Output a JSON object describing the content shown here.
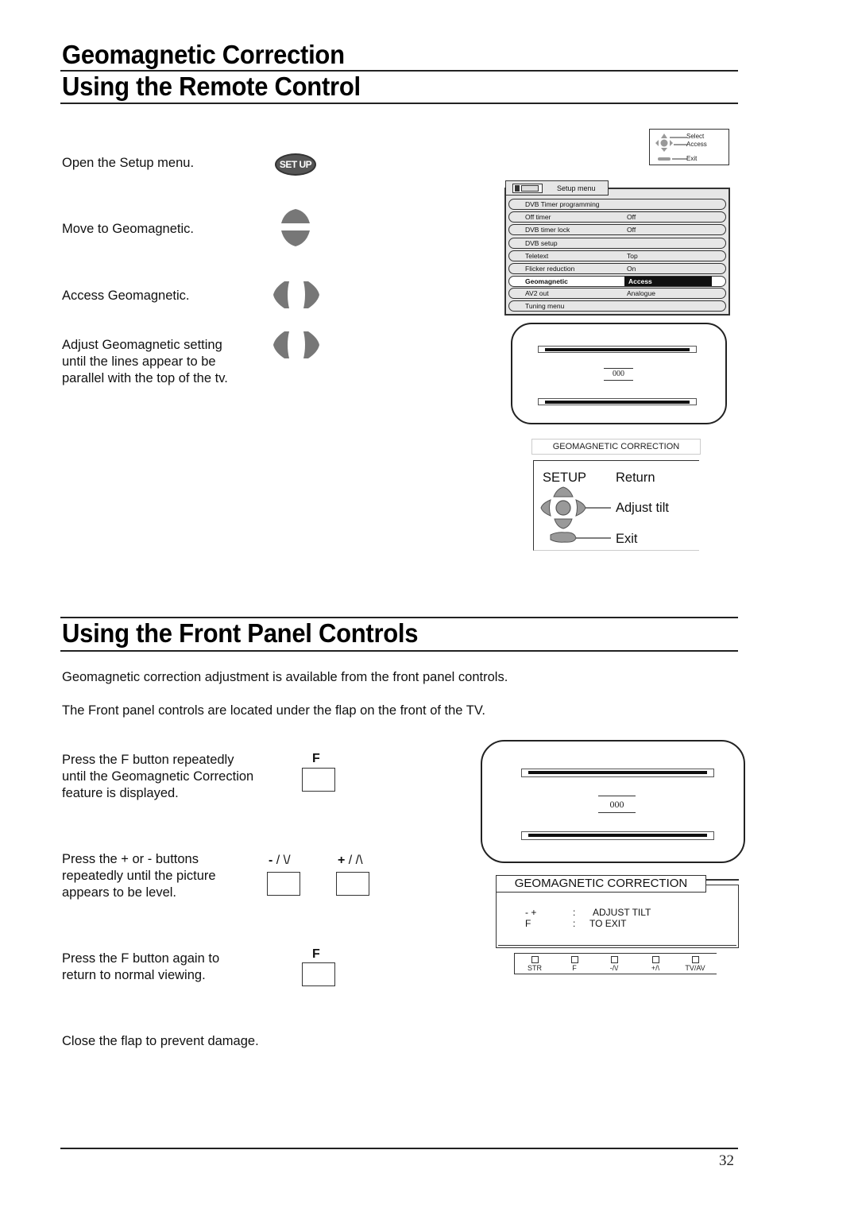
{
  "headings": {
    "title_line1": "Geomagnetic Correction",
    "title_line2": "Using the Remote Control",
    "front_panel": "Using the Front Panel Controls"
  },
  "remote_steps": [
    {
      "text": "Open the Setup menu.",
      "icon": "setup-button-icon",
      "icon_label": "SET UP"
    },
    {
      "text": "Move to Geomagnetic.",
      "icon": "up-down-arrows-icon"
    },
    {
      "text": "Access Geomagnetic.",
      "icon": "left-right-arrows-icon"
    },
    {
      "text_lines": [
        "Adjust Geomagnetic setting",
        "until the lines appear to be",
        "parallel with the top of the tv."
      ],
      "icon": "left-right-arrows-icon"
    }
  ],
  "nav_hint": {
    "select": "Select",
    "access": "Access",
    "exit": "Exit"
  },
  "setup_menu": {
    "title": "Setup menu",
    "items": [
      {
        "label": "DVB Timer programming",
        "value": ""
      },
      {
        "label": "Off timer",
        "value": "Off"
      },
      {
        "label": "DVB timer  lock",
        "value": "Off"
      },
      {
        "label": "DVB setup",
        "value": ""
      },
      {
        "label": "Teletext",
        "value": "Top"
      },
      {
        "label": "Flicker reduction",
        "value": "On"
      },
      {
        "label": "Geomagnetic",
        "value": "Access",
        "selected": true
      },
      {
        "label": "AV2 out",
        "value": "Analogue"
      },
      {
        "label": "Tuning menu",
        "value": ""
      }
    ]
  },
  "remote_screen": {
    "value": "000"
  },
  "remote_legend": {
    "caption": "GEOMAGNETIC CORRECTION",
    "setup_key": "SETUP",
    "return": "Return",
    "adjust": "Adjust tilt",
    "exit": "Exit"
  },
  "front_panel": {
    "intro1": "Geomagnetic correction adjustment is available from the front panel controls.",
    "intro2": "The Front panel controls are located under the flap on the front of the TV.",
    "steps": [
      {
        "lines": [
          "Press the F button repeatedly",
          "until the Geomagnetic Correction",
          "feature is displayed."
        ]
      },
      {
        "lines": [
          "Press the + or - buttons",
          "repeatedly until the picture",
          "appears to be level."
        ]
      },
      {
        "lines": [
          "Press the F button again to",
          "return to normal viewing."
        ]
      }
    ],
    "closing": "Close the flap to prevent damage.",
    "button_f": "F",
    "button_minus_sym": "-",
    "button_minus_rest": " / \\/",
    "button_plus_sym": "+",
    "button_plus_rest": " / /\\",
    "screen_value": "000",
    "osd": {
      "title": "GEOMAGNETIC CORRECTION",
      "row1_keys": "-  +",
      "row1_sep": ":",
      "row1_text": "ADJUST TILT",
      "row2_keys": "F",
      "row2_sep": ":",
      "row2_text": "TO EXIT"
    },
    "keys": [
      "STR",
      "F",
      "-/\\/",
      "+/\\",
      "TV/AV"
    ]
  },
  "page_number": "32"
}
